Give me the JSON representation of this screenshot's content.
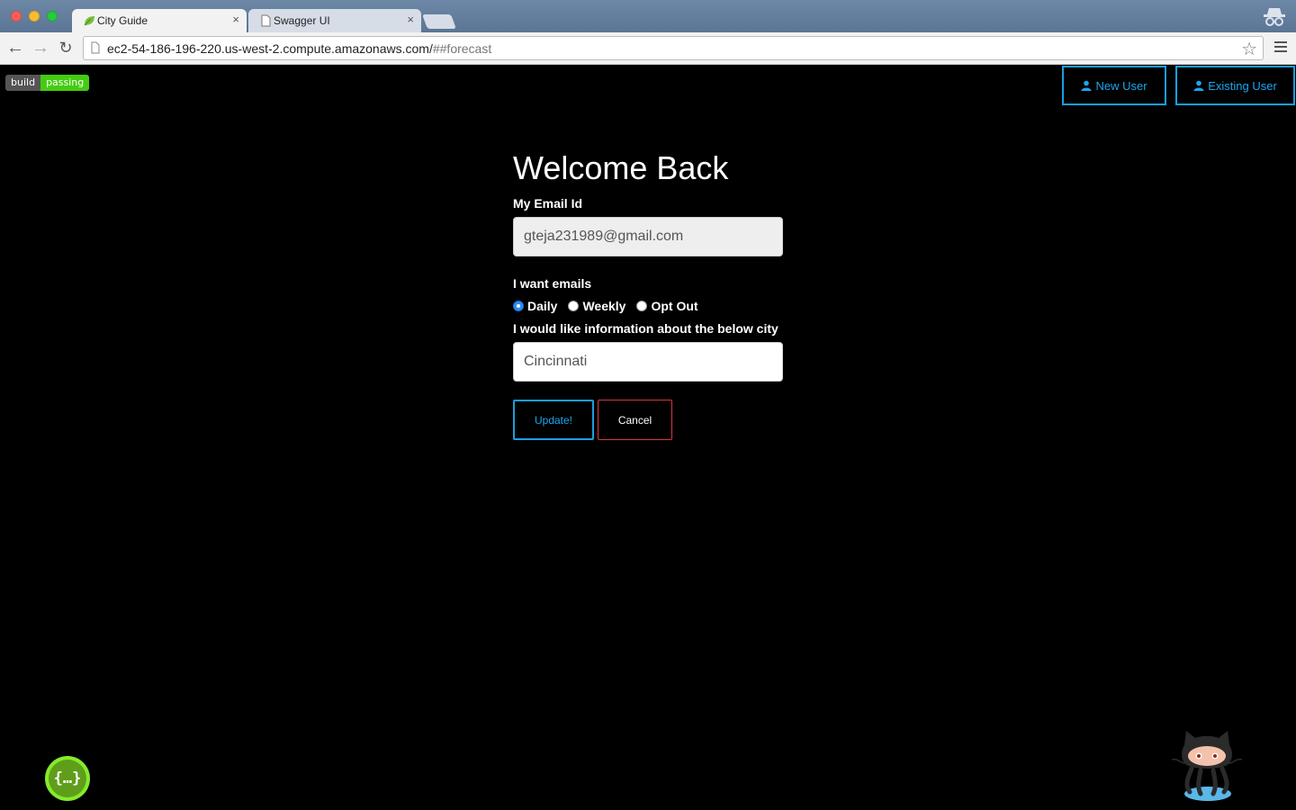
{
  "browser": {
    "tabs": [
      {
        "title": "City Guide",
        "active": true
      },
      {
        "title": "Swagger UI",
        "active": false
      }
    ],
    "close_glyph": "×",
    "url_main": "ec2-54-186-196-220.us-west-2.compute.amazonaws.com/",
    "url_hash": "##forecast"
  },
  "badge": {
    "left": "build",
    "right": "passing"
  },
  "header": {
    "new_user_label": "New User",
    "existing_user_label": "Existing User"
  },
  "form": {
    "title": "Welcome Back",
    "email_label": "My Email Id",
    "email_value": "gteja231989@gmail.com",
    "emails_label": "I want emails",
    "email_options": [
      {
        "label": "Daily",
        "checked": true
      },
      {
        "label": "Weekly",
        "checked": false
      },
      {
        "label": "Opt Out",
        "checked": false
      }
    ],
    "city_label": "I would like information about the below city",
    "city_value": "Cincinnati",
    "update_label": "Update!",
    "cancel_label": "Cancel"
  },
  "footer": {
    "swagger_glyph": "{…}"
  },
  "colors": {
    "accent": "#1aa7ef",
    "cancel_border": "#d9363e",
    "badge_green": "#44cc11",
    "swagger_green": "#85ea2d"
  },
  "icons": [
    "leaf-favicon-icon",
    "document-favicon-icon",
    "incognito-icon",
    "back-arrow-icon",
    "forward-arrow-icon",
    "reload-icon",
    "page-icon",
    "bookmark-star-icon",
    "menu-icon",
    "user-icon",
    "swagger-logo-icon",
    "octocat-icon"
  ]
}
